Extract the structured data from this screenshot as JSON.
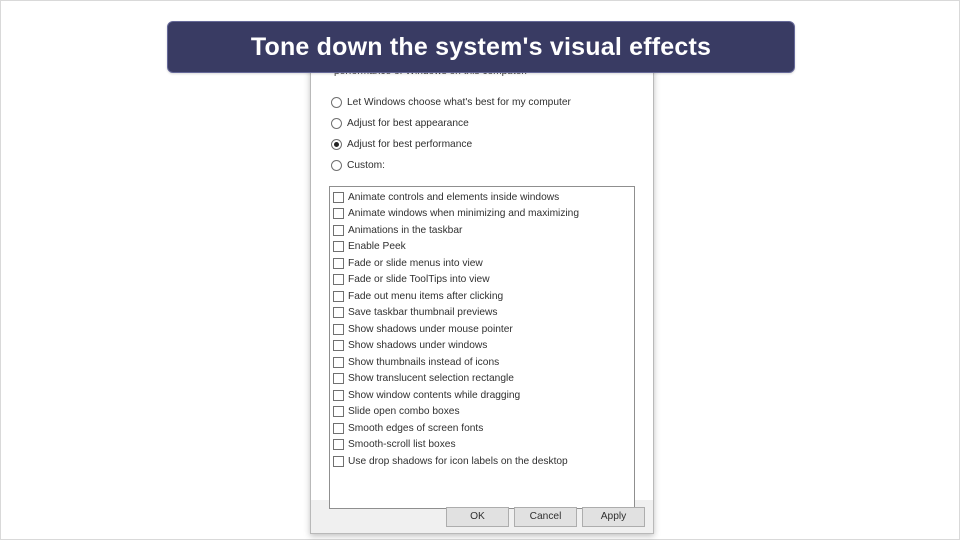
{
  "title": "Tone down the system's visual effects",
  "dialog": {
    "description_fragment": "performance of Windows on this computer.",
    "radios": [
      {
        "label": "Let Windows choose what's best for my computer",
        "checked": false
      },
      {
        "label": "Adjust for best appearance",
        "checked": false
      },
      {
        "label": "Adjust for best performance",
        "checked": true
      },
      {
        "label": "Custom:",
        "checked": false
      }
    ],
    "checks": [
      "Animate controls and elements inside windows",
      "Animate windows when minimizing and maximizing",
      "Animations in the taskbar",
      "Enable Peek",
      "Fade or slide menus into view",
      "Fade or slide ToolTips into view",
      "Fade out menu items after clicking",
      "Save taskbar thumbnail previews",
      "Show shadows under mouse pointer",
      "Show shadows under windows",
      "Show thumbnails instead of icons",
      "Show translucent selection rectangle",
      "Show window contents while dragging",
      "Slide open combo boxes",
      "Smooth edges of screen fonts",
      "Smooth-scroll list boxes",
      "Use drop shadows for icon labels on the desktop"
    ],
    "buttons": {
      "ok": "OK",
      "cancel": "Cancel",
      "apply": "Apply"
    }
  }
}
